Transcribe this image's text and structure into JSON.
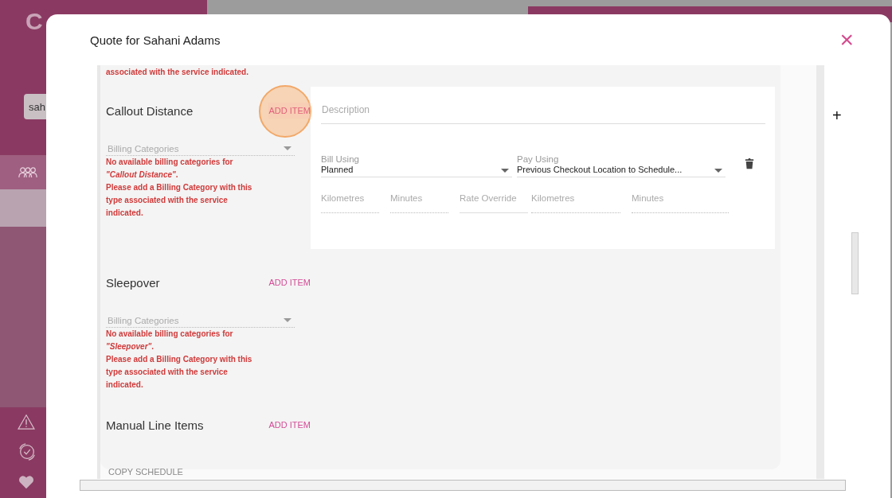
{
  "background": {
    "logo": "C",
    "search": {
      "value": "sah"
    }
  },
  "dialog": {
    "title": "Quote for Sahani Adams",
    "close": "×"
  },
  "cut_error": "associated with the service indicated.",
  "sections": [
    {
      "title": "Callout Distance",
      "action": "ADD ITEM",
      "highlighted": true,
      "billing": {
        "placeholder": "Billing Categories",
        "disabled": true
      },
      "errors": [
        "No available billing categories for *\"Callout Distance\"*.",
        "Please add a Billing Category with this type associated with the service indicated."
      ],
      "items": [
        {
          "description": {
            "placeholder": "Description"
          },
          "selects": [
            {
              "label": "Bill Using",
              "value": "Planned"
            },
            {
              "label": "Pay Using",
              "value": "Previous Checkout Location to Schedule..."
            }
          ],
          "fields": [
            {
              "placeholder": "Kilometres",
              "disabled": true
            },
            {
              "placeholder": "Minutes",
              "disabled": true
            },
            {
              "placeholder": "Rate Override",
              "disabled": false
            },
            {
              "placeholder": "Kilometres",
              "disabled": true
            },
            {
              "placeholder": "Minutes",
              "disabled": true
            }
          ]
        }
      ]
    },
    {
      "title": "Sleepover",
      "action": "ADD ITEM",
      "highlighted": false,
      "billing": {
        "placeholder": "Billing Categories",
        "disabled": true
      },
      "errors": [
        "No available billing categories for *\"Sleepover\"*.",
        "Please add a Billing Category with this type associated with the service indicated."
      ]
    },
    {
      "title": "Manual Line Items",
      "action": "ADD ITEM",
      "highlighted": false
    }
  ],
  "copy_button": "COPY SCHEDULE",
  "side": {
    "add": "+"
  }
}
